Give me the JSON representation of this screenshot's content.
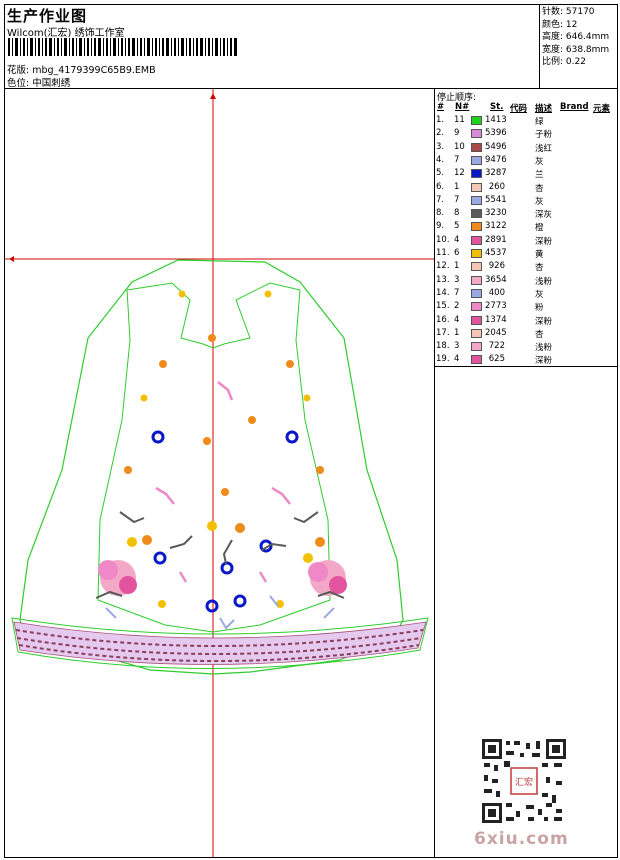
{
  "header": {
    "title": "生产作业图",
    "subtitle": "Wilcom(汇宏) 绣饰工作室",
    "design_label": "花版: mbg_4179399C65B9.EMB",
    "color_label": "色位: 中国刺绣"
  },
  "stats": {
    "stitches": "针数: 57170",
    "colors": "颜色: 12",
    "height": "高度: 646.4mm",
    "width": "宽度: 638.8mm",
    "scale": "比例: 0.22"
  },
  "legend": {
    "title": "停止顺序:",
    "headers": {
      "seq": "#",
      "n": "N#",
      "st": "St.",
      "code": "代码",
      "desc": "描述",
      "brand": "Brand",
      "elem": "元素"
    },
    "rows": [
      {
        "seq": "1.",
        "n": "11",
        "code": "1413",
        "desc": "绿",
        "color": "#1fd21f"
      },
      {
        "seq": "2.",
        "n": "9",
        "code": "5396",
        "desc": "子粉",
        "color": "#d98ad6"
      },
      {
        "seq": "3.",
        "n": "10",
        "code": "5496",
        "desc": "浅红",
        "color": "#a84a4a"
      },
      {
        "seq": "4.",
        "n": "7",
        "code": "9476",
        "desc": "灰",
        "color": "#9aa8e6"
      },
      {
        "seq": "5.",
        "n": "12",
        "code": "3287",
        "desc": "兰",
        "color": "#0a18c8"
      },
      {
        "seq": "6.",
        "n": "1",
        "code": "260",
        "desc": "杏",
        "color": "#f3c6b6"
      },
      {
        "seq": "7.",
        "n": "7",
        "code": "5541",
        "desc": "灰",
        "color": "#9aa8e6"
      },
      {
        "seq": "8.",
        "n": "8",
        "code": "3230",
        "desc": "深灰",
        "color": "#5a5a5a"
      },
      {
        "seq": "9.",
        "n": "5",
        "code": "3122",
        "desc": "橙",
        "color": "#f08a1a"
      },
      {
        "seq": "10.",
        "n": "4",
        "code": "2891",
        "desc": "深粉",
        "color": "#e2559e"
      },
      {
        "seq": "11.",
        "n": "6",
        "code": "4537",
        "desc": "黄",
        "color": "#f2c000"
      },
      {
        "seq": "12.",
        "n": "1",
        "code": "926",
        "desc": "杏",
        "color": "#f3c6b6"
      },
      {
        "seq": "13.",
        "n": "3",
        "code": "3654",
        "desc": "浅粉",
        "color": "#f4a8c8"
      },
      {
        "seq": "14.",
        "n": "7",
        "code": "400",
        "desc": "灰",
        "color": "#9aa8e6"
      },
      {
        "seq": "15.",
        "n": "2",
        "code": "2773",
        "desc": "粉",
        "color": "#ee88c6"
      },
      {
        "seq": "16.",
        "n": "4",
        "code": "1374",
        "desc": "深粉",
        "color": "#e2559e"
      },
      {
        "seq": "17.",
        "n": "1",
        "code": "2045",
        "desc": "杏",
        "color": "#f3c6b6"
      },
      {
        "seq": "18.",
        "n": "3",
        "code": "722",
        "desc": "浅粉",
        "color": "#f4a8c8"
      },
      {
        "seq": "19.",
        "n": "4",
        "code": "625",
        "desc": "深粉",
        "color": "#e2559e"
      }
    ]
  },
  "watermark": {
    "site": "6xiu.com",
    "qr_badge": "汇宏"
  },
  "colors": {
    "outline": "#2ecc2e",
    "guide": "#d40000"
  }
}
